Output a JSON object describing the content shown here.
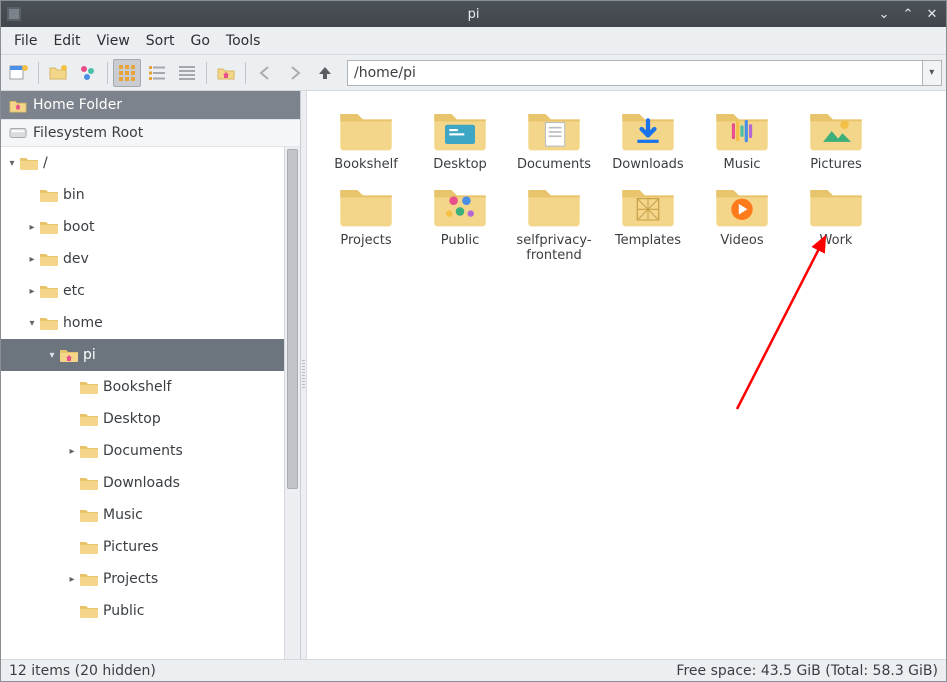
{
  "window": {
    "title": "pi"
  },
  "menubar": [
    "File",
    "Edit",
    "View",
    "Sort",
    "Go",
    "Tools"
  ],
  "toolbar": {
    "addr": "/home/pi"
  },
  "places": {
    "home_label": "Home Folder",
    "fsroot_label": "Filesystem Root"
  },
  "tree": {
    "root": "/",
    "nodes": [
      {
        "label": "bin",
        "depth": 1,
        "exp": ""
      },
      {
        "label": "boot",
        "depth": 1,
        "exp": "▸"
      },
      {
        "label": "dev",
        "depth": 1,
        "exp": "▸"
      },
      {
        "label": "etc",
        "depth": 1,
        "exp": "▸"
      },
      {
        "label": "home",
        "depth": 1,
        "exp": "▾"
      },
      {
        "label": "pi",
        "depth": 2,
        "exp": "▾",
        "selected": true,
        "home": true
      },
      {
        "label": "Bookshelf",
        "depth": 3,
        "exp": ""
      },
      {
        "label": "Desktop",
        "depth": 3,
        "exp": ""
      },
      {
        "label": "Documents",
        "depth": 3,
        "exp": "▸"
      },
      {
        "label": "Downloads",
        "depth": 3,
        "exp": ""
      },
      {
        "label": "Music",
        "depth": 3,
        "exp": ""
      },
      {
        "label": "Pictures",
        "depth": 3,
        "exp": ""
      },
      {
        "label": "Projects",
        "depth": 3,
        "exp": "▸"
      },
      {
        "label": "Public",
        "depth": 3,
        "exp": ""
      }
    ]
  },
  "items": [
    {
      "label": "Bookshelf",
      "icon": "folder"
    },
    {
      "label": "Desktop",
      "icon": "desktop"
    },
    {
      "label": "Documents",
      "icon": "documents"
    },
    {
      "label": "Downloads",
      "icon": "downloads"
    },
    {
      "label": "Music",
      "icon": "music"
    },
    {
      "label": "Pictures",
      "icon": "pictures"
    },
    {
      "label": "Projects",
      "icon": "folder"
    },
    {
      "label": "Public",
      "icon": "public"
    },
    {
      "label": "selfprivacy-frontend",
      "icon": "folder"
    },
    {
      "label": "Templates",
      "icon": "templates"
    },
    {
      "label": "Videos",
      "icon": "videos"
    },
    {
      "label": "Work",
      "icon": "folder"
    }
  ],
  "status": {
    "left": "12 items (20 hidden)",
    "right": "Free space: 43.5 GiB (Total: 58.3 GiB)"
  },
  "colors": {
    "folder_fill": "#f4d68b",
    "folder_tab": "#e8c46c"
  }
}
